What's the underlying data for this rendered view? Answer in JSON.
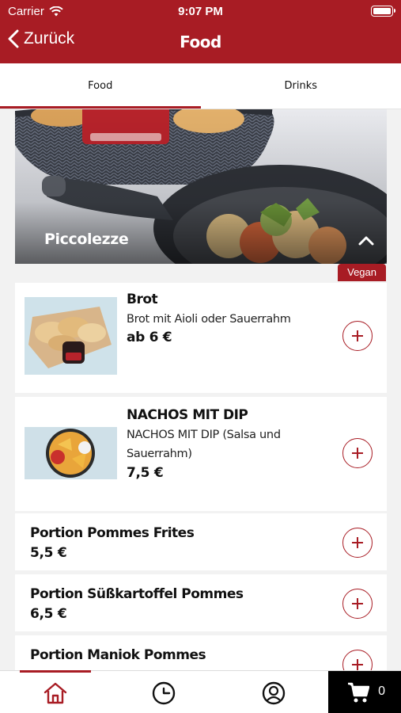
{
  "status": {
    "carrier": "Carrier",
    "time": "9:07 PM"
  },
  "nav": {
    "back_label": "Zurück",
    "title": "Food"
  },
  "tabs": [
    {
      "label": "Food",
      "active": true
    },
    {
      "label": "Drinks",
      "active": false
    }
  ],
  "category": {
    "title": "Piccolezze",
    "badge": "Vegan"
  },
  "items": [
    {
      "name": "Brot",
      "description": "Brot mit Aioli oder Sauerrahm",
      "price": "ab 6 €"
    },
    {
      "name": "NACHOS MIT DIP",
      "description_line1": "NACHOS MIT DIP (Salsa und",
      "description_line2": "Sauerrahm)",
      "price": "7,5 €"
    },
    {
      "name": "Portion Pommes Frites",
      "price": "5,5 €"
    },
    {
      "name": "Portion Süßkartoffel Pommes",
      "price": "6,5 €"
    },
    {
      "name": "Portion Maniok Pommes"
    }
  ],
  "bottom_nav": {
    "cart_count": "0"
  },
  "colors": {
    "brand": "#a81c24"
  },
  "icons": [
    "wifi-icon",
    "battery-icon",
    "back-chevron-icon",
    "chevron-up-icon",
    "plus-icon",
    "home-icon",
    "clock-icon",
    "profile-icon",
    "cart-icon"
  ]
}
